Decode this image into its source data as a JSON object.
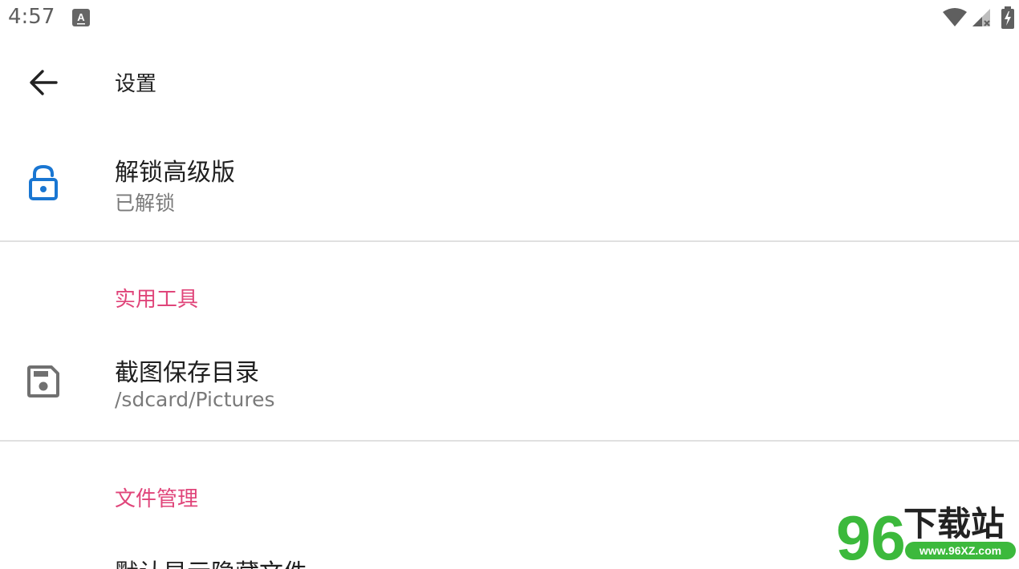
{
  "status_bar": {
    "time": "4:57",
    "notification_icon": "a-keyboard-icon",
    "wifi_icon": "wifi-icon",
    "cell_icon": "cell-signal-icon",
    "battery_icon": "battery-charging-icon"
  },
  "app_bar": {
    "title": "设置"
  },
  "items": [
    {
      "title": "解锁高级版",
      "subtitle": "已解锁",
      "icon": "lock-open-icon",
      "icon_color": "#1976d2"
    },
    {
      "title": "截图保存目录",
      "subtitle": "/sdcard/Pictures",
      "icon": "save-icon",
      "icon_color": "#707070"
    },
    {
      "title": "默认显示隐藏文件"
    }
  ],
  "sections": {
    "tools": "实用工具",
    "files": "文件管理"
  },
  "colors": {
    "accent": "#e0457a",
    "primary_text": "#1f1f1f",
    "secondary_text": "#7a7a7a"
  },
  "watermark": {
    "number": "96",
    "text": "下载站",
    "url": "www.96XZ.com"
  }
}
